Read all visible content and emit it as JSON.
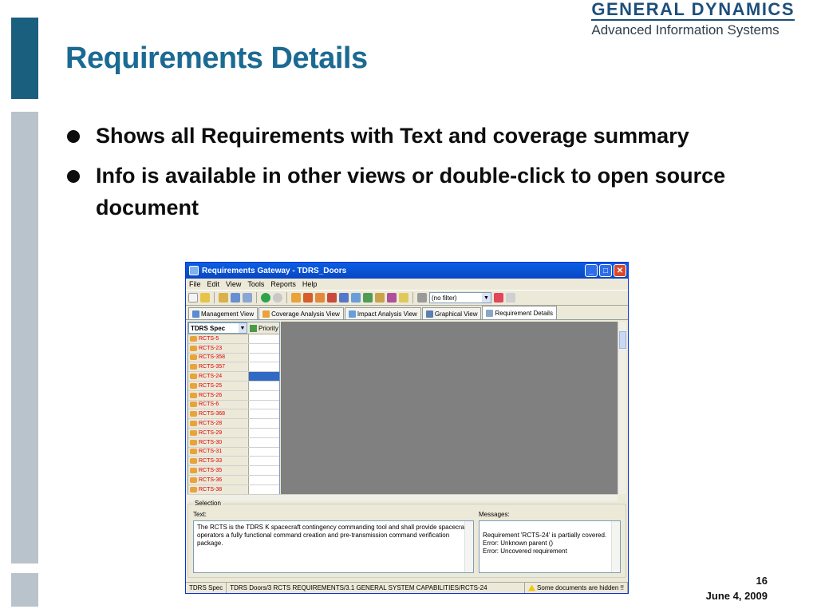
{
  "slide": {
    "title": "Requirements Details",
    "bullets": [
      "Shows all Requirements with Text and coverage summary",
      "Info is available in other views or double-click to open source document"
    ],
    "page_number": "16",
    "date": "June 4, 2009",
    "logo_name": "GENERAL DYNAMICS",
    "logo_sub": "Advanced Information Systems",
    "accent_color": "#1b6a93"
  },
  "window": {
    "title": "Requirements Gateway - TDRS_Doors",
    "menu": [
      "File",
      "Edit",
      "View",
      "Tools",
      "Reports",
      "Help"
    ],
    "filter_value": "(no filter)",
    "tabs": [
      "Management View",
      "Coverage Analysis View",
      "Impact Analysis View",
      "Graphical View",
      "Requirement Details"
    ],
    "active_tab": "Requirement Details",
    "spec_selector": "TDRS Spec",
    "priority_label": "Priority",
    "requirements": [
      "RCTS-5",
      "RCTS-23",
      "RCTS-358",
      "RCTS-357",
      "RCTS-24",
      "RCTS-25",
      "RCTS-26",
      "RCTS-6",
      "RCTS-368",
      "RCTS-28",
      "RCTS-29",
      "RCTS-30",
      "RCTS-31",
      "RCTS-33",
      "RCTS-35",
      "RCTS-36",
      "RCTS-38"
    ],
    "selected_requirement": "RCTS-24",
    "selection_legend": "Selection",
    "text_label": "Text:",
    "text_value": "The RCTS is the TDRS K spacecraft contingency commanding tool and shall provide spacecraft operators a fully functional command creation and pre-transmission command verification package.",
    "messages_label": "Messages:",
    "messages_value": "Requirement 'RCTS-24' is partially covered.\nError: Unknown parent ()\nError: Uncovered requirement",
    "status_spec": "TDRS Spec",
    "status_path": "TDRS Doors/3 RCTS REQUIREMENTS/3.1 GENERAL SYSTEM CAPABILITIES/RCTS-24",
    "status_warning": "Some documents are hidden !!"
  }
}
